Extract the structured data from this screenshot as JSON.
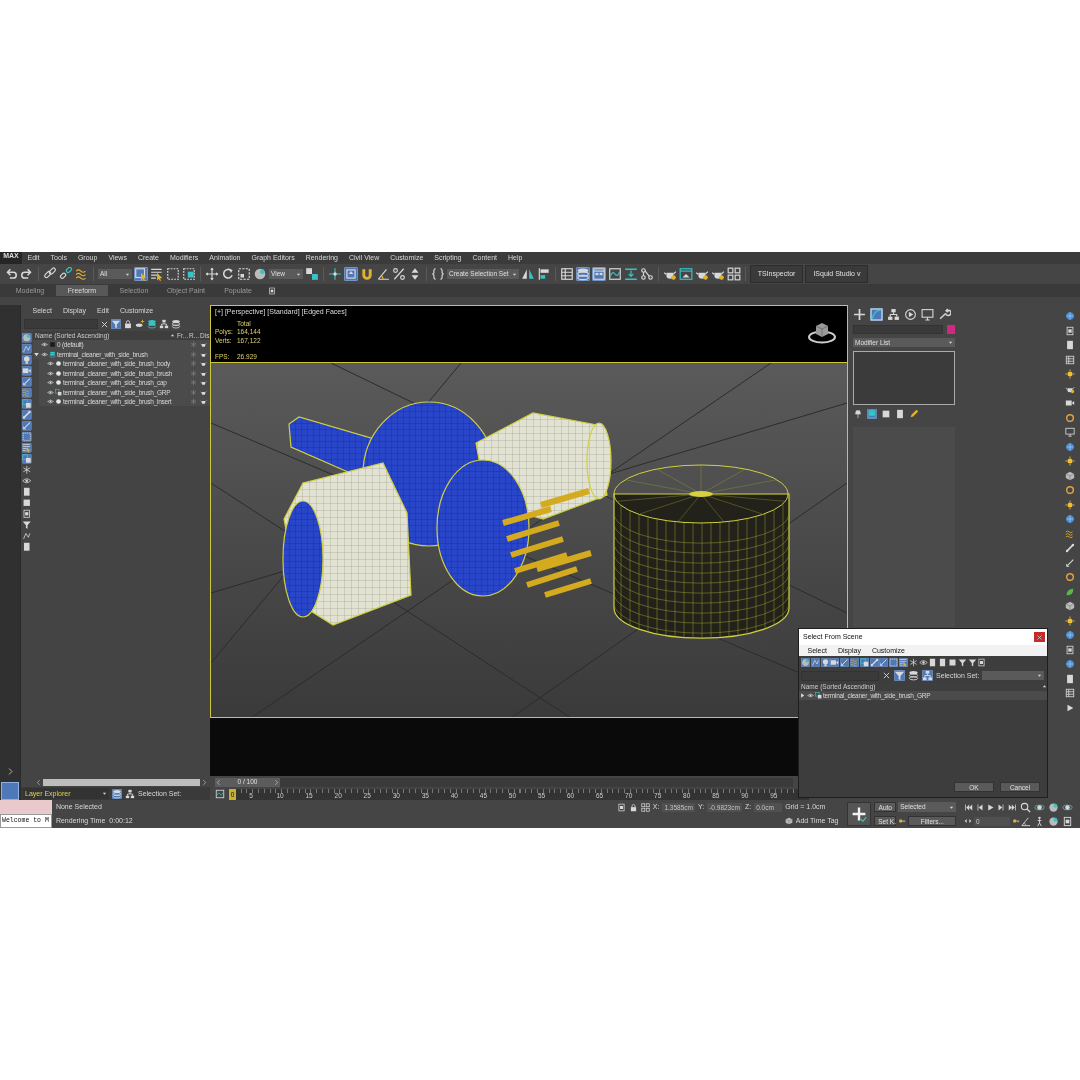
{
  "app": {
    "logo": "MAX"
  },
  "menu_bar": [
    "Edit",
    "Tools",
    "Group",
    "Views",
    "Create",
    "Modifiers",
    "Animation",
    "Graph Editors",
    "Rendering",
    "Civil View",
    "Customize",
    "Scripting",
    "Content",
    "Help"
  ],
  "toolbar": {
    "groups": [
      [
        {
          "kind": "undo",
          "on": false
        },
        {
          "kind": "redo",
          "on": false
        }
      ],
      [
        {
          "kind": "link",
          "on": false
        },
        {
          "kind": "unlink",
          "on": false
        },
        {
          "kind": "wave",
          "on": false
        }
      ],
      [
        {
          "kind": "dropdown",
          "value": "All"
        },
        {
          "kind": "select",
          "on": true
        },
        {
          "kind": "list",
          "on": false
        },
        {
          "kind": "rect",
          "on": false
        },
        {
          "kind": "window",
          "on": false
        }
      ],
      [
        {
          "kind": "move",
          "on": false
        },
        {
          "kind": "rotate",
          "on": false
        },
        {
          "kind": "scale",
          "on": false
        },
        {
          "kind": "sphere",
          "on": false
        },
        {
          "kind": "dropdown",
          "value": "View"
        },
        {
          "kind": "pivot",
          "on": false
        }
      ],
      [
        {
          "kind": "axes",
          "on": false
        },
        {
          "kind": "manip",
          "on": true
        },
        {
          "kind": "snap",
          "on": false
        },
        {
          "kind": "angle",
          "on": false
        },
        {
          "kind": "percent",
          "on": false
        },
        {
          "kind": "spinner",
          "on": false
        }
      ],
      [
        {
          "kind": "braces",
          "on": false
        },
        {
          "kind": "dropdown",
          "value": "Create Selection Set"
        },
        {
          "kind": "mirror",
          "on": false
        },
        {
          "kind": "align",
          "on": false
        }
      ],
      [
        {
          "kind": "table",
          "on": false
        },
        {
          "kind": "layers",
          "on": true
        },
        {
          "kind": "ribbon",
          "on": true
        },
        {
          "kind": "curve",
          "on": false
        },
        {
          "kind": "download",
          "on": false
        },
        {
          "kind": "schematic",
          "on": false
        }
      ],
      [
        {
          "kind": "teapot",
          "on": false
        },
        {
          "kind": "frame",
          "on": false
        },
        {
          "kind": "teapot",
          "on": false
        },
        {
          "kind": "teapot",
          "on": false
        },
        {
          "kind": "grid4",
          "on": false
        }
      ],
      [
        {
          "kind": "button",
          "label": "TSInspector"
        },
        {
          "kind": "button",
          "label": "ISquid Studio v"
        }
      ]
    ]
  },
  "ribbon_tabs": [
    {
      "label": "Modeling",
      "selected": false
    },
    {
      "label": "Freeform",
      "selected": true
    },
    {
      "label": "Selection",
      "selected": false
    },
    {
      "label": "Object Paint",
      "selected": false
    },
    {
      "label": "Populate",
      "selected": false
    }
  ],
  "scene_explorer": {
    "menu": [
      "Select",
      "Display",
      "Edit",
      "Customize"
    ],
    "toggles": [
      {
        "kind": "funnel",
        "on": true
      },
      {
        "kind": "lock",
        "on": false
      },
      {
        "kind": "addlayer",
        "on": false
      },
      {
        "kind": "stack",
        "on": false
      },
      {
        "kind": "hierarchy",
        "on": false
      },
      {
        "kind": "layers",
        "on": false
      }
    ],
    "filters": [
      {
        "kind": "sphere",
        "on": true
      },
      {
        "kind": "shape",
        "on": true
      },
      {
        "kind": "light",
        "on": true
      },
      {
        "kind": "camera",
        "on": true
      },
      {
        "kind": "helper",
        "on": true
      },
      {
        "kind": "wave",
        "on": true
      },
      {
        "kind": "grp",
        "on": true
      },
      {
        "kind": "bone",
        "on": true
      },
      {
        "kind": "helper",
        "on": true
      },
      {
        "kind": "rect",
        "on": true
      },
      {
        "kind": "list",
        "on": true
      },
      {
        "kind": "grp",
        "on": true
      },
      {
        "kind": "snow",
        "on": false
      },
      {
        "kind": "eye",
        "on": false
      },
      {
        "kind": "page",
        "on": false
      },
      {
        "kind": "box",
        "on": false
      },
      {
        "kind": "frame2",
        "on": false
      },
      {
        "kind": "funnel",
        "on": false
      },
      {
        "kind": "shape",
        "on": false
      },
      {
        "kind": "page",
        "on": false
      }
    ],
    "columns": [
      "Name (Sorted Ascending)",
      "Fr...",
      "R...",
      "Dis"
    ],
    "rows": [
      {
        "name": "0 (default)",
        "kind": "layer",
        "active": false
      },
      {
        "name": "terminal_cleaner_with_side_brush",
        "kind": "layer",
        "active": true,
        "expanded": true,
        "children": [
          {
            "name": "terminal_cleaner_with_side_brush_body",
            "kind": "object"
          },
          {
            "name": "terminal_cleaner_with_side_brush_brush",
            "kind": "object"
          },
          {
            "name": "terminal_cleaner_with_side_brush_cap",
            "kind": "object"
          },
          {
            "name": "terminal_cleaner_with_side_brush_GRP",
            "kind": "group"
          },
          {
            "name": "terminal_cleaner_with_side_brush_insert",
            "kind": "object"
          }
        ]
      }
    ],
    "footer": {
      "dropdown": "Layer Explorer",
      "selection_set_label": "Selection Set:"
    }
  },
  "viewport": {
    "label": "[+] [Perspective] [Standard] [Edged Faces]",
    "stats_header": "Total",
    "stats": [
      {
        "label": "Polys:",
        "value": "164,144"
      },
      {
        "label": "Verts:",
        "value": "167,122"
      }
    ],
    "fps_label": "FPS:",
    "fps": "26.929"
  },
  "time_slider": {
    "label": "0 / 100",
    "level": 0
  },
  "track_bar": {
    "current": "0",
    "ticks": [
      "5",
      "10",
      "15",
      "20",
      "25",
      "30",
      "35",
      "40",
      "45",
      "50",
      "55",
      "60",
      "65",
      "70",
      "75",
      "80",
      "85",
      "90",
      "95"
    ]
  },
  "command_panel": {
    "tabs": [
      {
        "kind": "plus",
        "selected": false
      },
      {
        "kind": "modify",
        "selected": true
      },
      {
        "kind": "hierarchy",
        "selected": false
      },
      {
        "kind": "motion",
        "selected": false
      },
      {
        "kind": "display",
        "selected": false
      },
      {
        "kind": "wrench",
        "selected": false
      }
    ],
    "color": "#d0287f",
    "modifier_list": "Modifier List",
    "stack_tools": [
      {
        "kind": "pin",
        "on": false
      },
      {
        "kind": "stack",
        "on": true
      },
      {
        "kind": "box",
        "on": false
      },
      {
        "kind": "page",
        "on": false
      },
      {
        "kind": "pencil",
        "on": false
      }
    ]
  },
  "select_from_scene": {
    "title": "Select From Scene",
    "menu": [
      "Select",
      "Display",
      "Customize"
    ],
    "filters": [
      {
        "kind": "sphere",
        "on": true
      },
      {
        "kind": "shape",
        "on": true
      },
      {
        "kind": "light",
        "on": true
      },
      {
        "kind": "camera",
        "on": true
      },
      {
        "kind": "helper",
        "on": true
      },
      {
        "kind": "wave",
        "on": true
      },
      {
        "kind": "grp",
        "on": true
      },
      {
        "kind": "bone",
        "on": true
      },
      {
        "kind": "helper",
        "on": true
      },
      {
        "kind": "rect",
        "on": true
      },
      {
        "kind": "list",
        "on": true
      },
      {
        "kind": "snow",
        "on": false
      },
      {
        "kind": "eye",
        "on": false
      },
      {
        "kind": "page",
        "on": false
      },
      {
        "kind": "page",
        "on": false
      },
      {
        "kind": "box",
        "on": false
      },
      {
        "kind": "funnel",
        "on": false
      },
      {
        "kind": "funnel",
        "on": false
      },
      {
        "kind": "frame2",
        "on": false
      }
    ],
    "toggles": [
      {
        "kind": "funnel",
        "on": true
      },
      {
        "kind": "layers",
        "on": false
      },
      {
        "kind": "hierarchy",
        "on": true
      }
    ],
    "selection_set_label": "Selection Set:",
    "column": "Name (Sorted Ascending)",
    "rows": [
      {
        "name": "terminal_cleaner_with_side_brush_GRP",
        "kind": "group",
        "expanded": false
      }
    ],
    "buttons": [
      "OK",
      "Cancel"
    ]
  },
  "status_bar": {
    "listener": "Welcome to M",
    "prompt": "None Selected",
    "render_label": "Rendering Time",
    "render_time": "0:00:12",
    "coordinates": [
      {
        "axis": "X:",
        "value": "1.3585cm"
      },
      {
        "axis": "Y:",
        "value": "-0.9823cm"
      },
      {
        "axis": "Z:",
        "value": "0.0cm"
      }
    ],
    "grid": "Grid = 1.0cm",
    "time_tag": "Add Time Tag",
    "auto": "Auto",
    "key_mode": "Selected",
    "set_key": "Set K.",
    "filters": "Filters...",
    "frame": "0"
  }
}
